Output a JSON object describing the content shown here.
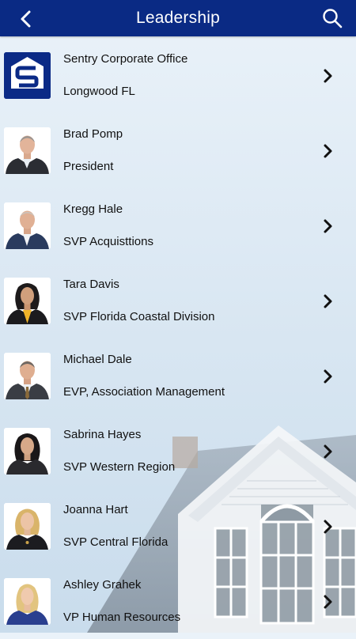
{
  "header": {
    "title": "Leadership",
    "back_icon": "chevron-left-icon",
    "search_icon": "search-icon",
    "color": "#0a2a84"
  },
  "people": [
    {
      "name": "Sentry Corporate Office",
      "subtitle": "Longwood FL",
      "avatar": "logo"
    },
    {
      "name": "Brad Pomp",
      "subtitle": "President",
      "avatar": "man-dark-suit"
    },
    {
      "name": "Kregg Hale",
      "subtitle": "SVP Acquisttions",
      "avatar": "man-navy-jacket"
    },
    {
      "name": "Tara Davis",
      "subtitle": "SVP Florida Coastal Division",
      "avatar": "woman-dark-hair"
    },
    {
      "name": "Michael Dale",
      "subtitle": "EVP, Association Management",
      "avatar": "man-grey-suit"
    },
    {
      "name": "Sabrina Hayes",
      "subtitle": "SVP Western Region",
      "avatar": "woman-dark-hair"
    },
    {
      "name": "Joanna Hart",
      "subtitle": "SVP Central Florida",
      "avatar": "woman-blonde"
    },
    {
      "name": "Ashley Grahek",
      "subtitle": "VP Human Resources",
      "avatar": "woman-blonde-blue"
    }
  ]
}
